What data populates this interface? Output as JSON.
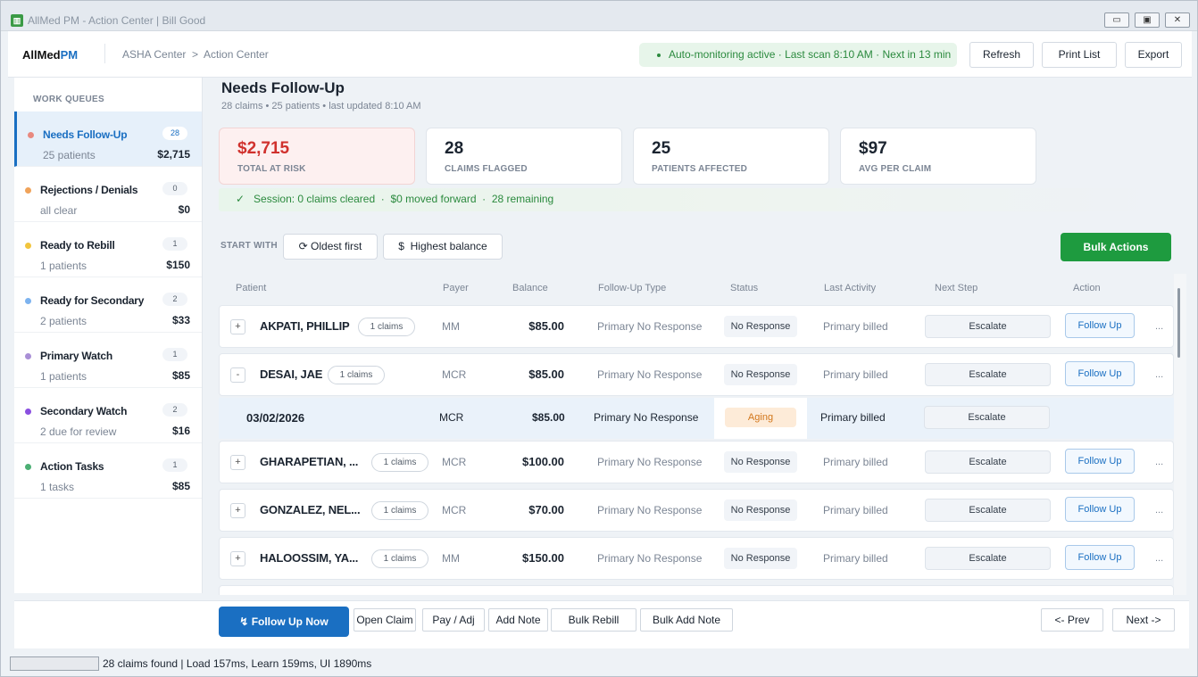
{
  "window": {
    "title": "AllMed PM - Action Center | Bill Good",
    "controls": [
      "minimize",
      "maximize",
      "close"
    ]
  },
  "header": {
    "logo_main": "AllMed",
    "logo_accent": "PM",
    "breadcrumb": "ASHA Center  >  Action Center",
    "monitor_label": "Auto-monitoring active",
    "monitor_scan": "Last scan 8:10 AM",
    "monitor_next": "Next in 13 min",
    "refresh": "Refresh",
    "print_list": "Print List",
    "export": "Export"
  },
  "sidebar": {
    "heading": "WORK QUEUES",
    "queues": [
      {
        "name": "Needs Follow-Up",
        "sub": "25 patients",
        "count": "28",
        "amount": "$2,715",
        "color": "#e8897f"
      },
      {
        "name": "Rejections / Denials",
        "sub": "all clear",
        "count": "0",
        "amount": "$0",
        "color": "#f0a35a"
      },
      {
        "name": "Ready to Rebill",
        "sub": "1 patients",
        "count": "1",
        "amount": "$150",
        "color": "#f2c53d"
      },
      {
        "name": "Ready for Secondary",
        "sub": "2 patients",
        "count": "2",
        "amount": "$33",
        "color": "#7db3ef"
      },
      {
        "name": "Primary Watch",
        "sub": "1 patients",
        "count": "1",
        "amount": "$85",
        "color": "#a98fd6"
      },
      {
        "name": "Secondary Watch",
        "sub": "2 due for review",
        "count": "2",
        "amount": "$16",
        "color": "#8a4fe0"
      },
      {
        "name": "Action Tasks",
        "sub": "1 tasks",
        "count": "1",
        "amount": "$85",
        "color": "#4caf74"
      }
    ]
  },
  "main": {
    "title": "Needs Follow-Up",
    "subtitle": "28 claims • 25 patients • last updated 8:10 AM",
    "stats": [
      {
        "value": "$2,715",
        "label": "TOTAL AT RISK"
      },
      {
        "value": "28",
        "label": "CLAIMS FLAGGED"
      },
      {
        "value": "25",
        "label": "PATIENTS AFFECTED"
      },
      {
        "value": "$97",
        "label": "AVG PER CLAIM"
      }
    ],
    "session": "✓   Session: 0 claims cleared  ·  $0 moved forward  ·  28 remaining",
    "start_with": "START WITH",
    "oldest_first": "⟳ Oldest first",
    "highest_balance": "$  Highest balance",
    "bulk_actions": "Bulk Actions"
  },
  "table": {
    "columns": [
      "Patient",
      "Payer",
      "Balance",
      "Follow-Up Type",
      "Status",
      "Last Activity",
      "Next Step",
      "Action"
    ],
    "rows": [
      {
        "toggle": "+",
        "patient": "AKPATI, PHILLIP",
        "claims": "1 claims",
        "payer": "MM",
        "balance": "$85.00",
        "followup": "Primary No Response",
        "status": "No Response",
        "last": "Primary billed",
        "next": "Escalate",
        "action": "Follow Up",
        "more": "..."
      },
      {
        "toggle": "-",
        "patient": "DESAI, JAE",
        "claims": "1 claims",
        "payer": "MCR",
        "balance": "$85.00",
        "followup": "Primary No Response",
        "status": "No Response",
        "last": "Primary billed",
        "next": "Escalate",
        "action": "Follow Up",
        "more": "..."
      },
      {
        "toggle": "+",
        "patient": "GHARAPETIAN, ...",
        "claims": "1 claims",
        "payer": "MCR",
        "balance": "$100.00",
        "followup": "Primary No Response",
        "status": "No Response",
        "last": "Primary billed",
        "next": "Escalate",
        "action": "Follow Up",
        "more": "..."
      },
      {
        "toggle": "+",
        "patient": "GONZALEZ, NEL...",
        "claims": "1 claims",
        "payer": "MCR",
        "balance": "$70.00",
        "followup": "Primary No Response",
        "status": "No Response",
        "last": "Primary billed",
        "next": "Escalate",
        "action": "Follow Up",
        "more": "..."
      },
      {
        "toggle": "+",
        "patient": "HALOOSSIM, YA...",
        "claims": "1 claims",
        "payer": "MM",
        "balance": "$150.00",
        "followup": "Primary No Response",
        "status": "No Response",
        "last": "Primary billed",
        "next": "Escalate",
        "action": "Follow Up",
        "more": "..."
      }
    ],
    "detail": {
      "date": "03/02/2026",
      "payer": "MCR",
      "balance": "$85.00",
      "followup": "Primary No Response",
      "status": "Aging",
      "last": "Primary billed",
      "next": "Escalate"
    }
  },
  "footer": {
    "follow_up_now": "Follow Up Now",
    "open_claim": "Open Claim",
    "pay_adj": "Pay / Adj",
    "add_note": "Add Note",
    "bulk_rebill": "Bulk Rebill",
    "bulk_add_note": "Bulk Add Note",
    "prev": "<- Prev",
    "next": "Next ->"
  },
  "status_bar": {
    "text": "28 claims found | Load 157ms, Learn 159ms, UI 1890ms",
    "progress": 0
  }
}
